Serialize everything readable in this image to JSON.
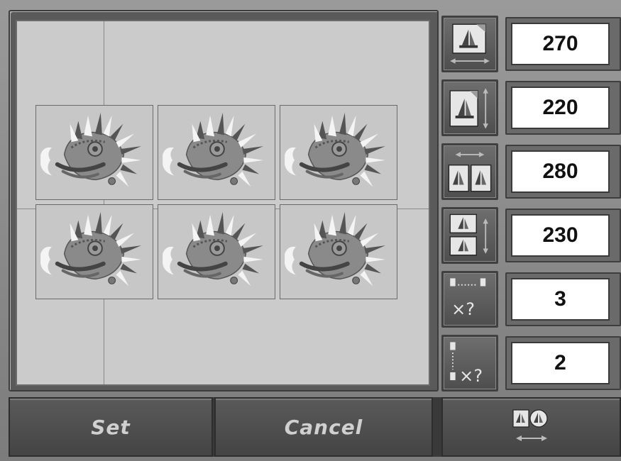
{
  "values": {
    "width": "270",
    "height": "220",
    "h_spacing": "280",
    "v_spacing": "230",
    "columns": "3",
    "rows": "2"
  },
  "buttons": {
    "set_label": "Set",
    "cancel_label": "Cancel"
  },
  "icons": {
    "width": "design-width-icon",
    "height": "design-height-icon",
    "h_spacing": "horizontal-spacing-icon",
    "v_spacing": "vertical-spacing-icon",
    "columns": "column-count-icon",
    "rows": "row-count-icon",
    "extra": "layout-swap-icon",
    "tile": "embroidery-motif-icon"
  },
  "colors": {
    "canvas": "#cbcbcb",
    "panel": "#7c7c7c",
    "value_box": "#ffffff",
    "button": "#4e4e4e"
  }
}
